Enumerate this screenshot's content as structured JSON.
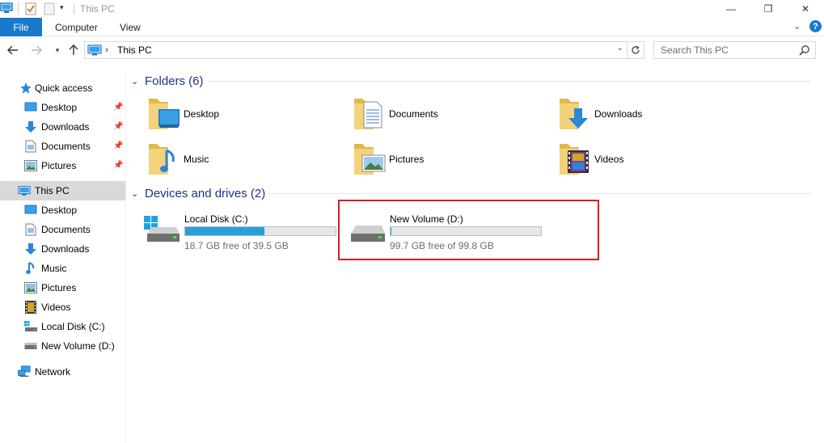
{
  "window": {
    "title": "This PC",
    "controls": {
      "minimize": "—",
      "maximize": "❐",
      "close": "✕"
    }
  },
  "ribbon": {
    "tabs": [
      {
        "label": "File"
      },
      {
        "label": "Computer"
      },
      {
        "label": "View"
      }
    ],
    "expand_icon": "chevron-down-icon",
    "help_label": "?"
  },
  "navigation": {
    "address_path": "This PC",
    "search_placeholder": "Search This PC"
  },
  "sidebar": {
    "quick_access": {
      "label": "Quick access",
      "items": [
        {
          "label": "Desktop",
          "pinned": true
        },
        {
          "label": "Downloads",
          "pinned": true
        },
        {
          "label": "Documents",
          "pinned": true
        },
        {
          "label": "Pictures",
          "pinned": true
        }
      ]
    },
    "this_pc": {
      "label": "This PC",
      "selected": true,
      "items": [
        {
          "label": "Desktop"
        },
        {
          "label": "Documents"
        },
        {
          "label": "Downloads"
        },
        {
          "label": "Music"
        },
        {
          "label": "Pictures"
        },
        {
          "label": "Videos"
        },
        {
          "label": "Local Disk (C:)"
        },
        {
          "label": "New Volume (D:)"
        }
      ]
    },
    "network": {
      "label": "Network"
    }
  },
  "main": {
    "folders_group": {
      "title": "Folders (6)",
      "items": [
        {
          "label": "Desktop",
          "icon": "desktop-folder-icon"
        },
        {
          "label": "Documents",
          "icon": "documents-folder-icon"
        },
        {
          "label": "Downloads",
          "icon": "downloads-folder-icon"
        },
        {
          "label": "Music",
          "icon": "music-folder-icon"
        },
        {
          "label": "Pictures",
          "icon": "pictures-folder-icon"
        },
        {
          "label": "Videos",
          "icon": "videos-folder-icon"
        }
      ]
    },
    "drives_group": {
      "title": "Devices and drives (2)",
      "items": [
        {
          "label": "Local Disk (C:)",
          "free_text": "18.7 GB free of 39.5 GB",
          "used_fraction": 0.527,
          "icon": "windows-drive-icon"
        },
        {
          "label": "New Volume (D:)",
          "free_text": "99.7 GB free of 99.8 GB",
          "used_fraction": 0.001,
          "icon": "hard-drive-icon"
        }
      ]
    }
  },
  "colors": {
    "accent": "#1979ca",
    "group_header": "#1e3287",
    "drive_bar": "#26a0da",
    "highlight": "#d61f1f"
  }
}
